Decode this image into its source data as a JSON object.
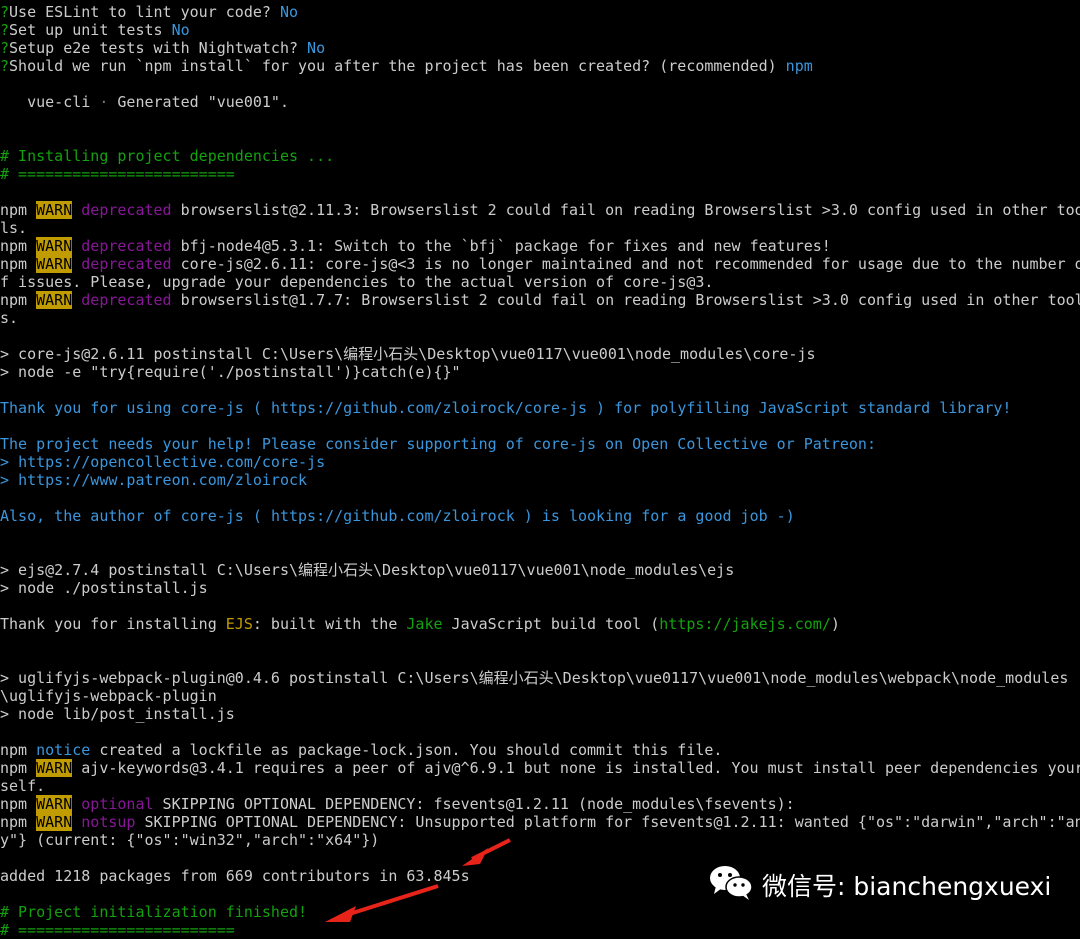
{
  "terminal": {
    "lines": [
      {
        "s": [
          [
            "g",
            "?"
          ],
          [
            "",
            "Use ESLint to lint your code?"
          ],
          [
            "c",
            " No"
          ]
        ]
      },
      {
        "s": [
          [
            "g",
            "?"
          ],
          [
            "",
            "Set up unit tests"
          ],
          [
            "c",
            " No"
          ]
        ]
      },
      {
        "s": [
          [
            "g",
            "?"
          ],
          [
            "",
            "Setup e2e tests with Nightwatch?"
          ],
          [
            "c",
            " No"
          ]
        ]
      },
      {
        "s": [
          [
            "g",
            "?"
          ],
          [
            "",
            "Should we run `npm install` for you after the project has been created? (recommended)"
          ],
          [
            "c",
            " npm"
          ]
        ]
      },
      {
        "s": []
      },
      {
        "s": [
          [
            "",
            "   vue-cli "
          ],
          [
            "dim",
            "·"
          ],
          [
            "",
            " Generated \"vue001\"."
          ]
        ]
      },
      {
        "s": []
      },
      {
        "s": []
      },
      {
        "s": [
          [
            "g",
            "# Installing project dependencies ..."
          ]
        ]
      },
      {
        "s": [
          [
            "g",
            "# ========================"
          ]
        ]
      },
      {
        "s": []
      },
      {
        "s": [
          [
            "",
            "npm "
          ],
          [
            "warn",
            "WARN"
          ],
          [
            "m",
            " deprecated"
          ],
          [
            "",
            " browserslist@2.11.3: Browserslist 2 could fail on reading Browserslist >3.0 config used in other too"
          ]
        ]
      },
      {
        "s": [
          [
            "",
            "ls."
          ]
        ]
      },
      {
        "s": [
          [
            "",
            "npm "
          ],
          [
            "warn",
            "WARN"
          ],
          [
            "m",
            " deprecated"
          ],
          [
            "",
            " bfj-node4@5.3.1: Switch to the `bfj` package for fixes and new features!"
          ]
        ]
      },
      {
        "s": [
          [
            "",
            "npm "
          ],
          [
            "warn",
            "WARN"
          ],
          [
            "m",
            " deprecated"
          ],
          [
            "",
            " core-js@2.6.11: core-js@<3 is no longer maintained and not recommended for usage due to the number o"
          ]
        ]
      },
      {
        "s": [
          [
            "",
            "f issues. Please, upgrade your dependencies to the actual version of core-js@3."
          ]
        ]
      },
      {
        "s": [
          [
            "",
            "npm "
          ],
          [
            "warn",
            "WARN"
          ],
          [
            "m",
            " deprecated"
          ],
          [
            "",
            " browserslist@1.7.7: Browserslist 2 could fail on reading Browserslist >3.0 config used in other tool"
          ]
        ]
      },
      {
        "s": [
          [
            "",
            "s."
          ]
        ]
      },
      {
        "s": []
      },
      {
        "s": [
          [
            "",
            "> core-js@2.6.11 postinstall C:\\Users\\编程小石头\\Desktop\\vue0117\\vue001\\node_modules\\core-js"
          ]
        ]
      },
      {
        "s": [
          [
            "",
            "> node -e \"try{require('./postinstall')}catch(e){}\""
          ]
        ]
      },
      {
        "s": []
      },
      {
        "s": [
          [
            "c",
            "Thank you for using core-js ( "
          ],
          [
            "c",
            "https://github.com/zloirock/core-js"
          ],
          [
            "c",
            " ) for polyfilling JavaScript standard library!"
          ]
        ]
      },
      {
        "s": []
      },
      {
        "s": [
          [
            "c",
            "The project needs your help! Please consider supporting of core-js on Open Collective or Patreon:"
          ]
        ]
      },
      {
        "s": [
          [
            "c",
            "> "
          ],
          [
            "c",
            "https://opencollective.com/core-js"
          ]
        ]
      },
      {
        "s": [
          [
            "c",
            "> "
          ],
          [
            "c",
            "https://www.patreon.com/zloirock"
          ]
        ]
      },
      {
        "s": []
      },
      {
        "s": [
          [
            "c",
            "Also, the author of core-js ( "
          ],
          [
            "c",
            "https://github.com/zloirock"
          ],
          [
            "c",
            " ) is looking for a good job -)"
          ]
        ]
      },
      {
        "s": []
      },
      {
        "s": []
      },
      {
        "s": [
          [
            "",
            "> ejs@2.7.4 postinstall C:\\Users\\编程小石头\\Desktop\\vue0117\\vue001\\node_modules\\ejs"
          ]
        ]
      },
      {
        "s": [
          [
            "",
            "> node ./postinstall.js"
          ]
        ]
      },
      {
        "s": []
      },
      {
        "s": [
          [
            "",
            "Thank you for installing "
          ],
          [
            "w",
            "EJS"
          ],
          [
            "",
            ": built with the "
          ],
          [
            "g",
            "Jake"
          ],
          [
            "",
            " JavaScript build tool ("
          ],
          [
            "g",
            "https://jakejs.com/"
          ],
          [
            "",
            ")"
          ]
        ]
      },
      {
        "s": []
      },
      {
        "s": []
      },
      {
        "s": [
          [
            "",
            "> uglifyjs-webpack-plugin@0.4.6 postinstall C:\\Users\\编程小石头\\Desktop\\vue0117\\vue001\\node_modules\\webpack\\node_modules"
          ]
        ]
      },
      {
        "s": [
          [
            "",
            "\\uglifyjs-webpack-plugin"
          ]
        ]
      },
      {
        "s": [
          [
            "",
            "> node lib/post_install.js"
          ]
        ]
      },
      {
        "s": []
      },
      {
        "s": [
          [
            "",
            "npm "
          ],
          [
            "c",
            "notice"
          ],
          [
            "",
            " created a lockfile as package-lock.json. You should commit this file."
          ]
        ]
      },
      {
        "s": [
          [
            "",
            "npm "
          ],
          [
            "warn",
            "WARN"
          ],
          [
            "",
            " ajv-keywords@3.4.1 requires a peer of ajv@^6.9.1 but none is installed. You must install peer dependencies your"
          ]
        ]
      },
      {
        "s": [
          [
            "",
            "self."
          ]
        ]
      },
      {
        "s": [
          [
            "",
            "npm "
          ],
          [
            "warn",
            "WARN"
          ],
          [
            "m",
            " optional"
          ],
          [
            "",
            " SKIPPING OPTIONAL DEPENDENCY: fsevents@1.2.11 (node_modules\\fsevents):"
          ]
        ]
      },
      {
        "s": [
          [
            "",
            "npm "
          ],
          [
            "warn",
            "WARN"
          ],
          [
            "m",
            " notsup"
          ],
          [
            "",
            " SKIPPING OPTIONAL DEPENDENCY: Unsupported platform for fsevents@1.2.11: wanted {\"os\":\"darwin\",\"arch\":\"an"
          ]
        ]
      },
      {
        "s": [
          [
            "",
            "y\"} (current: {\"os\":\"win32\",\"arch\":\"x64\"})"
          ]
        ]
      },
      {
        "s": []
      },
      {
        "s": [
          [
            "",
            "added 1218 packages from 669 contributors in 63.845s"
          ]
        ]
      },
      {
        "s": []
      },
      {
        "s": [
          [
            "g",
            "# Project initialization finished!"
          ]
        ]
      },
      {
        "s": [
          [
            "g",
            "# ========================"
          ]
        ]
      }
    ]
  },
  "watermark": {
    "icon": "wechat-icon",
    "text": "微信号: bianchengxuexi"
  },
  "colors": {
    "background": "#000000",
    "text": "#cccccc",
    "green": "#13a10e",
    "cyan": "#3a96dd",
    "warn": "#c19c00",
    "magenta": "#881798",
    "arrow": "#e8231a"
  }
}
